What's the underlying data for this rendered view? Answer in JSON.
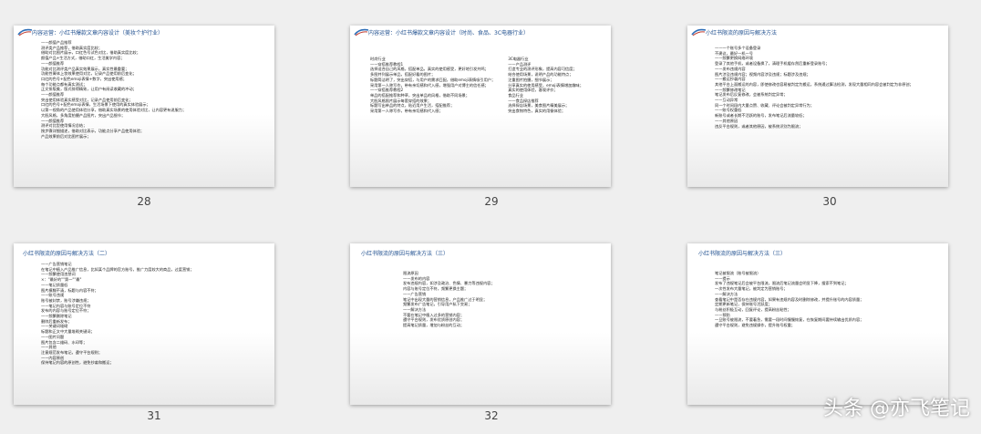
{
  "slides": [
    {
      "page": "28",
      "title": "内容运营：小红书爆款文章内容设计（美妆个护行业）",
      "lines": [
        "——颜值产品推荐",
        "测评类产品推荐，借助真实度比较；",
        "借助对比图片展示，口红色号试色对比，借助真实度比较；",
        "颜值产品+生活方式，借助口红，生活美学内容；",
        "——颜值推荐",
        "功能对比测评类产品真实效果展示，真实性最重要；",
        "功能性膏体上妆效果使用对比，记录产品使用前后变化；",
        "口红的色号+配色emoji表情+数字，突出使用感；",
        "每个功能点都有真实测试；",
        "正文排版美，版式排得精致，让用户有阅读收藏的冲动；",
        "——颜值推荐",
        "突出使用体验真实感受对比，记录产品使用前后变化；",
        "口红的色号+配色emoji表情，生活场景下使用的真实体验展示；",
        "以第一视角的产品使用体验分享，借助真实场景的使用体验对比，让内容更有说服力；",
        "大胆风格，多角度拍摄产品图片，突出产品细节；",
        "——颜值推荐",
        "测评对比型使用情况总结；",
        "按步骤详细描述，借助对比表示，功能点分享产品使用体验；",
        "产品效果前后对比图片展示；"
      ]
    },
    {
      "page": "29",
      "title": "内容运营：小红书爆款文章内容设计（时尚、食品、3C电器行业）",
      "left_lines": [
        "时尚行业",
        "——穿搭推荐教程1",
        "选择适合自己的风格，搭配单品，真实的使用感受，更好地引发共鸣；",
        "多图并列展示单品，搭配好看的图片；",
        "标题简洁明了，突出穿搭，与用户的需求匹配，借助emoji表情吸引用户；",
        "采用第一人称写作，带有亲切感和代入感，增强用户对博主的信任感；",
        "——穿搭推荐教程2",
        "单品的搭配推荐和种草，突出单品的风格，借助不同场景；",
        "大胆风格照片展示每套穿搭的效果；",
        "标题写出单品的特点，贴近用户生活，搭配推荐；",
        "采用第一人称写作，带有亲切感和代入感；"
      ],
      "right_lines": [
        "3C电器行业",
        "——产品测评",
        "打造专业的测评形象，提高内容可信度；",
        "结合使用场景，说明产品的功能特点；",
        "注重图片拍摄，细节展示；",
        "分享真实的使用感受，emoji表情增加趣味；",
        "真实的使用体验，客观评价；",
        "",
        "食品行业",
        "——食品探店推荐",
        "选择探店场景，美食图片精美展示；",
        "突出食物特色，真实的用餐体验；"
      ]
    },
    {
      "page": "30",
      "title": "小红书限流的原因与解决方法",
      "lines": [
        "——一个账号多个设备登录",
        "不建议，最好一机一号",
        "——频繁更换网络环境",
        "登录了其他手机，或者设备换了，清理手机缓存然后重新登录账号；",
        "——发布违规内容",
        "图片涉及违规内容；视频内容涉及违规；标题涉及违规；",
        "——搬运抄袭内容",
        "其他平台上面搬运的内容，即使修改也容易被判定为搬运，系统通过算法检测，发现大量相同内容会被判定为非原创；",
        "——频繁修改笔记",
        "笔记发布后反复修改，会被系统判定异常；",
        "——互动异常",
        "同一个时间段内大量点赞、收藏、评论会被判定异常行为；",
        "——账号权重低",
        "新账号或者长期不活跃的账号，发布笔记后流量较低；",
        "——其他原因",
        "违反平台规则，或者其他原因，被系统识别为限流；"
      ]
    },
    {
      "page": "31",
      "title": "小红书限流的原因与解决方法（二）",
      "lines": [
        "——广告营销笔记",
        "在笔记中植入产品推广信息，比如某个品牌的官方账号，推广力度较大的商品，过度营销；",
        "——频繁使用违禁词",
        "×：\"最好的\"\"第一\"\"最\"",
        "——笔记质量低",
        "图片模糊不清，标题与内容不符；",
        "——账号违规",
        "账号被封禁，账号涉嫌违规；",
        "——笔记内容与账号定位不符",
        "发布的内容与账号定位不符；",
        "——频繁删除笔记",
        "删除后重新发布；",
        "——关键词堆砌",
        "标题和正文中大量堆砌关键词；",
        "——图片问题",
        "图片包含二维码、水印等；",
        "——其他",
        "注意规范发布笔记，遵守平台规则；",
        "——内容原创",
        "保持笔记内容的原创性，避免抄袭和搬运；"
      ]
    },
    {
      "page": "32",
      "title": "小红书限流的原因与解决方法（三）",
      "lines": [
        "限流原因",
        "——发布的内容",
        "发布违规内容，如涉及政治、色情、暴力等违规内容；",
        "内容与账号定位不符，频繁更换主题；",
        "——广告营销",
        "笔记中出现大量的营销信息，产品推广过于明显；",
        "频繁发布广告笔记，引导用户私下交易；",
        "——解决方法",
        "不要在笔记中植入过多的营销内容；",
        "遵守平台规则，发布优质原创内容；",
        "提高笔记质量，增加与粉丝的互动；"
      ]
    },
    {
      "page": "33",
      "title": "小红书限流的原因与解决方法（三）",
      "lines": [
        "笔记被限流（账号被限流）",
        "——提示",
        "发布了违规笔记后会被平台限流，限流后笔记流量会明显下降，搜索不到笔记；",
        "一次性发布大量笔记，被判定为营销账号；",
        "——解决方法",
        "查看笔记中是否存在违规内容，如果有违规内容及时删除修改，并提升账号的内容质量；",
        "定期更新笔记，保持账号活跃度；",
        "与粉丝积极互动，回复评论，提高粉丝粘性；",
        "——预防",
        "一旦账号被限流，不要着急，需要一段时间慢慢恢复，在恢复期间要持续输出优质内容；",
        "遵守平台规则，避免违规操作，提升账号权重；"
      ]
    }
  ],
  "watermark": "头条 @亦飞笔记",
  "colors": {
    "title": "#1f4f8f",
    "accent_red": "#c0392b",
    "accent_blue": "#2e6fb8"
  }
}
